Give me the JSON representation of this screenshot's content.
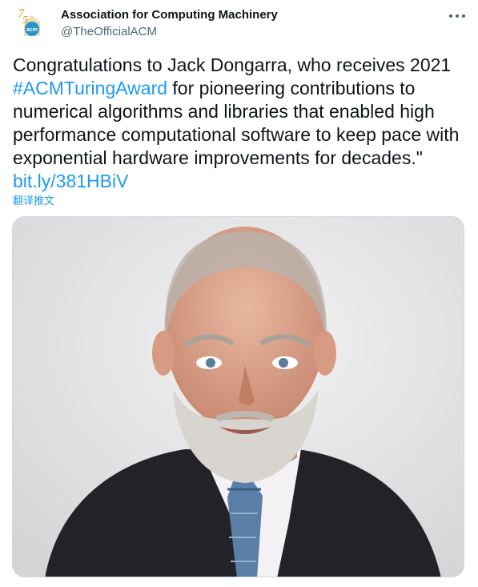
{
  "account": {
    "display_name": "Association for Computing Machinery",
    "handle": "@TheOfficialACM",
    "avatar": {
      "badge_text": "acm",
      "anniversary_number": "75",
      "accent_color": "#c9a227",
      "badge_color": "#2a93c9"
    }
  },
  "tweet": {
    "text_before_hashtag": "Congratulations to Jack Dongarra, who receives 2021 ",
    "hashtag": "#ACMTuringAward",
    "text_after_hashtag": " for pioneering contributions to numerical algorithms and libraries that enabled high performance computational software to keep pace with exponential hardware improvements for decades.\"",
    "link": "bit.ly/381HBiV",
    "translate_label": "翻译推文"
  },
  "icons": {
    "more": "more-horizontal-icon"
  },
  "colors": {
    "link": "#1d9bf0",
    "text": "#0f1419",
    "secondary": "#536471"
  }
}
